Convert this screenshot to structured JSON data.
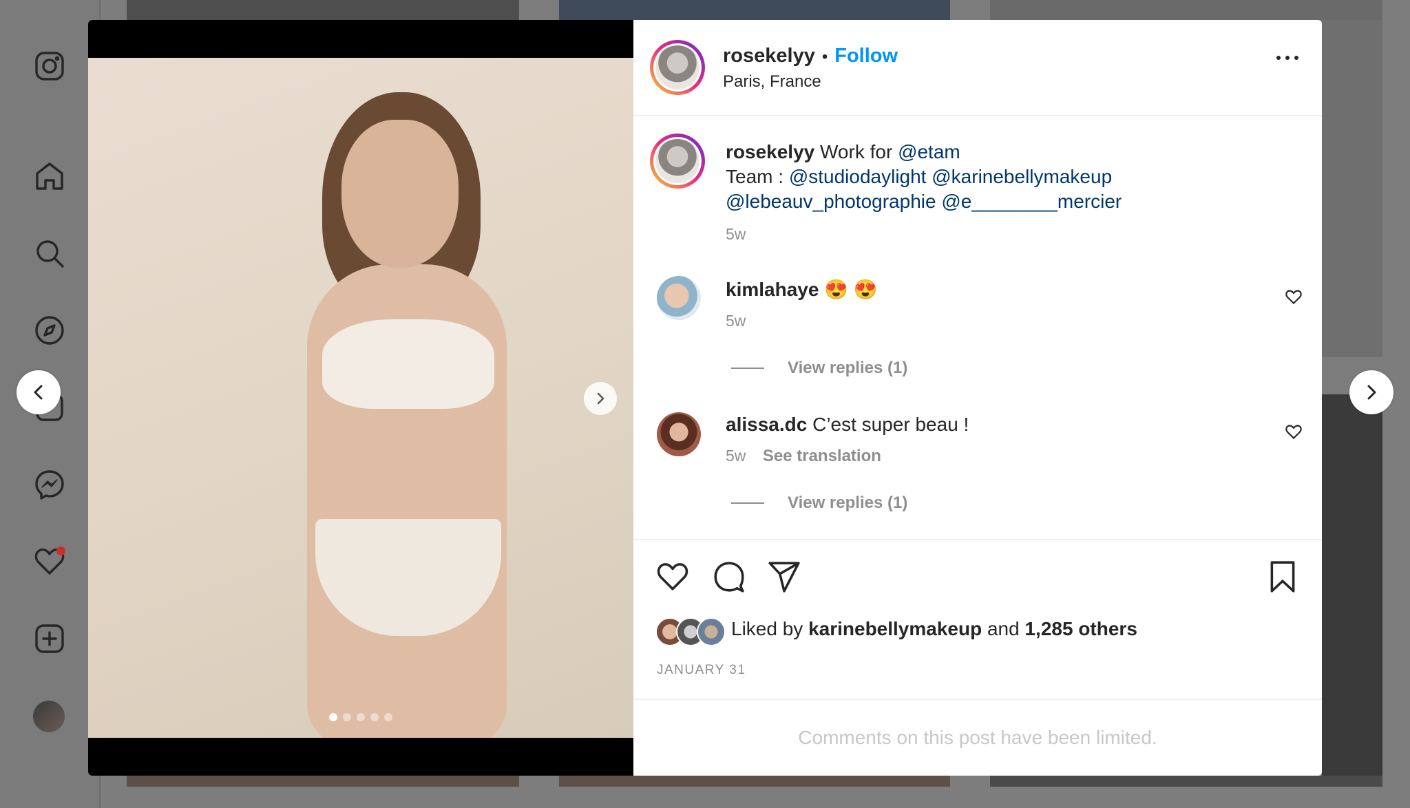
{
  "icons": {
    "sidebar": [
      "instagram-icon",
      "home-icon",
      "search-icon",
      "explore-icon",
      "reels-icon",
      "messenger-icon",
      "heart-icon",
      "create-icon"
    ],
    "actions": [
      "heart-icon",
      "comment-icon",
      "share-icon",
      "bookmark-icon"
    ]
  },
  "colors": {
    "follow": "#0095f6",
    "mention": "#00376b",
    "notification": "#c9302c"
  },
  "post": {
    "author": "rosekelyy",
    "separator": "•",
    "follow_label": "Follow",
    "location": "Paris, France",
    "slide_count": 5,
    "active_slide": 1
  },
  "caption": {
    "username": "rosekelyy",
    "text": "Work for",
    "mention_brand": "@etam",
    "team_label": "Team :",
    "mention_1": "@studiodaylight",
    "mention_2": "@karinebellymakeup",
    "mention_3": "@lebeauv_photographie",
    "mention_4": "@e________mercier",
    "time": "5w"
  },
  "comments": [
    {
      "username": "kimlahaye",
      "text": "😍 😍",
      "time": "5w",
      "replies": "View replies (1)"
    },
    {
      "username": "alissa.dc",
      "text": "C’est super beau !",
      "time": "5w",
      "translate": "See translation",
      "replies": "View replies (1)"
    }
  ],
  "likes": {
    "prefix": "Liked by",
    "liker": "karinebellymakeup",
    "and": "and",
    "others": "1,285 others",
    "date": "JANUARY 31"
  },
  "footer": {
    "limited": "Comments on this post have been limited."
  }
}
